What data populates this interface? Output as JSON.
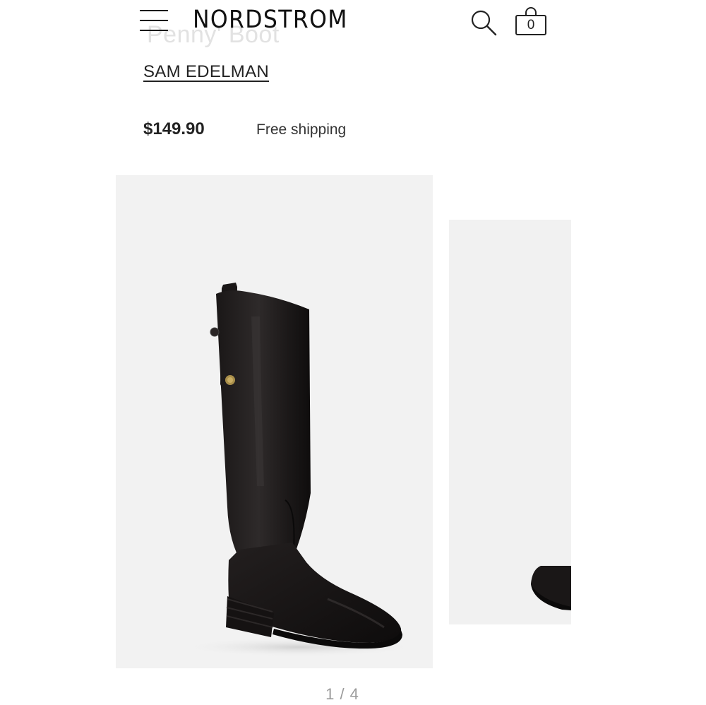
{
  "header": {
    "logo": "NORDSTROM",
    "bag_count": "0",
    "icons": {
      "menu": "hamburger-menu-icon",
      "search": "search-icon",
      "bag": "shopping-bag-icon"
    }
  },
  "product": {
    "title": "Penny' Boot",
    "brand": "SAM EDELMAN",
    "price": "$149.90",
    "shipping": "Free shipping"
  },
  "gallery": {
    "current": "1",
    "total": "4"
  },
  "colors": {
    "text": "#222222",
    "image_background": "#f2f2f2",
    "pager": "#9a9a9a"
  }
}
